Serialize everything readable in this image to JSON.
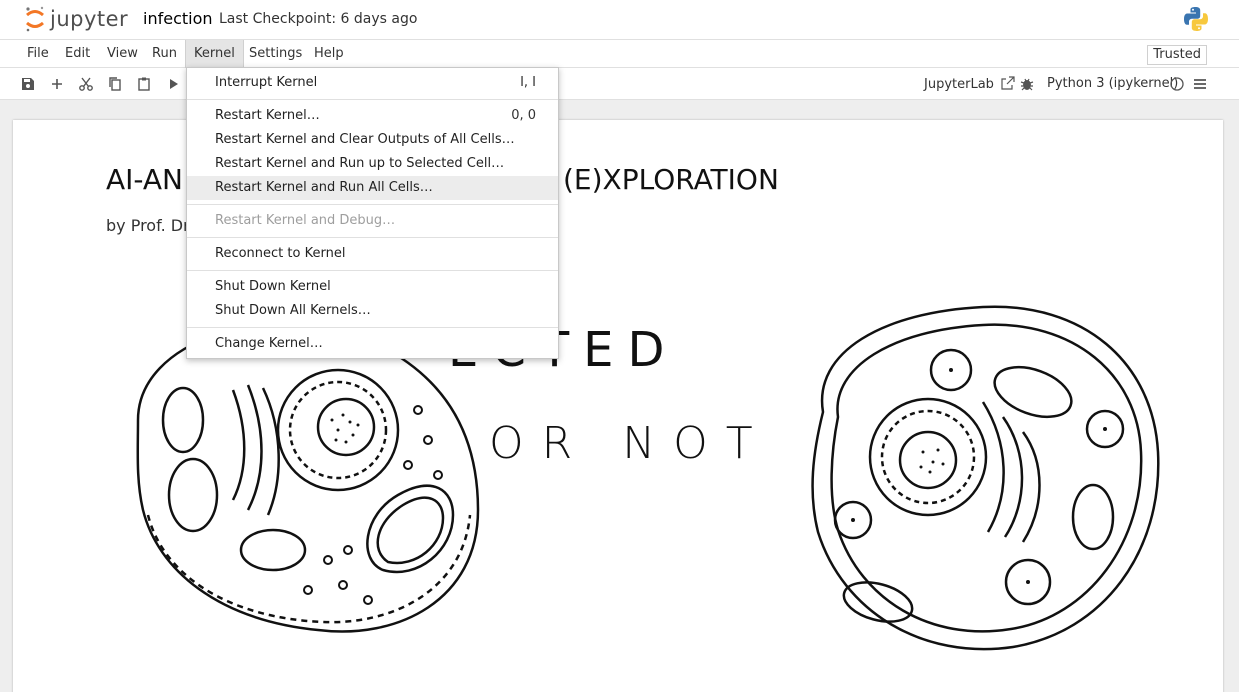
{
  "app": {
    "logo_text": "jupyter",
    "notebook_title": "infection",
    "checkpoint": "Last Checkpoint: 6 days ago",
    "brand_color": "#f37726"
  },
  "menubar": {
    "items": [
      "File",
      "Edit",
      "View",
      "Run",
      "Kernel",
      "Settings",
      "Help"
    ],
    "active": "Kernel",
    "trusted_label": "Trusted"
  },
  "toolbar": {
    "icons": [
      "save-icon",
      "add-cell-icon",
      "cut-icon",
      "copy-icon",
      "paste-icon",
      "run-icon"
    ],
    "jupyterlab_label": "JupyterLab",
    "kernel_label": "Python 3 (ipykernel)"
  },
  "kernel_menu": {
    "items": [
      {
        "label": "Interrupt Kernel",
        "shortcut": "I, I",
        "state": "normal"
      },
      {
        "label": "Restart Kernel…",
        "shortcut": "0, 0",
        "state": "normal"
      },
      {
        "label": "Restart Kernel and Clear Outputs of All Cells…",
        "shortcut": "",
        "state": "normal"
      },
      {
        "label": "Restart Kernel and Run up to Selected Cell…",
        "shortcut": "",
        "state": "normal"
      },
      {
        "label": "Restart Kernel and Run All Cells…",
        "shortcut": "",
        "state": "hover"
      },
      {
        "label": "Restart Kernel and Debug…",
        "shortcut": "",
        "state": "disabled"
      },
      {
        "label": "Reconnect to Kernel",
        "shortcut": "",
        "state": "normal"
      },
      {
        "label": "Shut Down Kernel",
        "shortcut": "",
        "state": "normal"
      },
      {
        "label": "Shut Down All Kernels…",
        "shortcut": "",
        "state": "normal"
      },
      {
        "label": "Change Kernel…",
        "shortcut": "",
        "state": "normal"
      }
    ]
  },
  "notebook": {
    "heading": "AI-AN                                              (E)XPLORATION",
    "heading_left": "AI-AN",
    "heading_right": "(E)XPLORATION",
    "byline": "by Prof. Dr",
    "illustration_word1": "INFECTED",
    "illustration_word1_visible": "ECTED",
    "illustration_word2": "OR NOT"
  }
}
